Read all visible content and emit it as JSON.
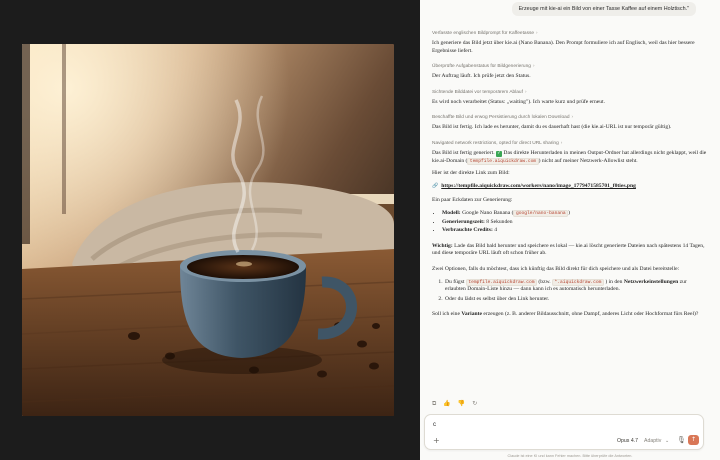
{
  "user_message": "Erzeuge mit kie-ai ein Bild von einer Tasse Kaffee auf einem Holztisch.\"",
  "steps": {
    "s1": "Verfasste englischen Bildprompt für Kaffeetasse",
    "s2": "Überprüfte Aufgabenstatus für Bildgenerierung",
    "s3": "Sichtende Bilddatei vor temporärem Ablauf",
    "s4": "Beschaffte Bild und erwog Persistierung durch lokalen Download",
    "s5": "Navigated network restrictions, opted for direct URL sharing"
  },
  "paragraphs": {
    "p1": "Ich generiere das Bild jetzt über kie.ai (Nano Banana). Den Prompt formuliere ich auf Englisch, weil das hier bessere Ergebnisse liefert.",
    "p2": "Der Auftrag läuft. Ich prüfe jetzt den Status.",
    "p3": "Es wird noch verarbeitet (Status: „waiting\"). Ich warte kurz und prüfe erneut.",
    "p4": "Das Bild ist fertig. Ich lade es herunter, damit du es dauerhaft hast (die kie.ai-URL ist nur temporär gültig).",
    "p5_a": "Das Bild ist fertig generiert.",
    "p5_b": "Das direkte Herunterladen in meinen Output-Ordner hat allerdings nicht geklappt, weil die kie.ai-Domain (",
    "p5_code": "tempfile.aiquickdraw.com",
    "p5_c": ") nicht auf meiner Netzwerk-Allowlist steht.",
    "p6": "Hier ist der direkte Link zum Bild:",
    "link": "https://tempfile.aiquickdraw.com/workers/nano/image_1779471585701_f0ties.png",
    "p7": "Ein paar Eckdaten zur Generierung:",
    "facts": {
      "model_label": "Modell:",
      "model_value": "Google Nano Banana (",
      "model_code": "google/nano-banana",
      "model_close": ")",
      "time_label": "Generierungszeit:",
      "time_value": "8 Sekunden",
      "credits_label": "Verbrauchte Credits:",
      "credits_value": "4"
    },
    "p8_label": "Wichtig:",
    "p8": "Lade das Bild bald herunter und speichere es lokal — kie.ai löscht generierte Dateien nach spätestens 14 Tagen, und diese temporäre URL läuft oft schon früher ab.",
    "p9": "Zwei Optionen, falls du möchtest, dass ich künftig das Bild direkt für dich speichere und als Datei bereitstelle:",
    "opt1_a": "Du fügst",
    "opt1_code1": "tempfile.aiquickdraw.com",
    "opt1_b": "(bzw.",
    "opt1_code2": "*.aiquickdraw.com",
    "opt1_c": ") in den",
    "opt1_bold": "Netzwerkeinstellungen",
    "opt1_d": "zur erlaubten Domain-Liste hinzu — dann kann ich es automatisch herunterladen.",
    "opt2": "Oder du lädst es selbst über den Link herunter.",
    "p10_a": "Soll ich eine",
    "p10_bold": "Variante",
    "p10_b": "erzeugen (z. B. anderer Bildausschnitt, ohne Dampf, anderes Licht oder Hochformat fürs Reel)?"
  },
  "composer": {
    "typed": "c",
    "model": "Opus 4.7",
    "mode": "Adaptiv"
  },
  "disclaimer": "Claude ist eine KI und kann Fehler machen. Bitte überprüfe die Antworten.",
  "colors": {
    "accent": "#d97757",
    "viewer_bg": "#1c1c1c",
    "code_text": "#b4412e"
  },
  "icons": [
    "copy-icon",
    "thumbs-up-icon",
    "thumbs-down-icon",
    "retry-icon",
    "plus-icon",
    "mic-icon",
    "send-arrow-icon",
    "link-icon",
    "check-icon"
  ]
}
